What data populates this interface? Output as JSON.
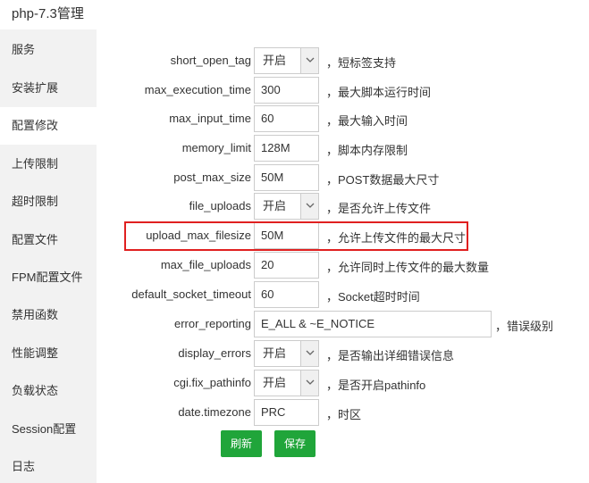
{
  "window": {
    "title": "php-7.3管理"
  },
  "sidebar": {
    "items": [
      {
        "label": "服务"
      },
      {
        "label": "安装扩展"
      },
      {
        "label": "配置修改"
      },
      {
        "label": "上传限制"
      },
      {
        "label": "超时限制"
      },
      {
        "label": "配置文件"
      },
      {
        "label": "FPM配置文件"
      },
      {
        "label": "禁用函数"
      },
      {
        "label": "性能调整"
      },
      {
        "label": "负载状态"
      },
      {
        "label": "Session配置"
      },
      {
        "label": "日志"
      }
    ],
    "active": "配置修改"
  },
  "settings": [
    {
      "name": "short_open_tag",
      "type": "select",
      "value": "开启",
      "desc": "，短标签支持"
    },
    {
      "name": "max_execution_time",
      "type": "text",
      "value": "300",
      "desc": "，最大脚本运行时间"
    },
    {
      "name": "max_input_time",
      "type": "text",
      "value": "60",
      "desc": "，最大输入时间"
    },
    {
      "name": "memory_limit",
      "type": "text",
      "value": "128M",
      "desc": "，脚本内存限制"
    },
    {
      "name": "post_max_size",
      "type": "text",
      "value": "50M",
      "desc": "，POST数据最大尺寸"
    },
    {
      "name": "file_uploads",
      "type": "select",
      "value": "开启",
      "desc": "，是否允许上传文件"
    },
    {
      "name": "upload_max_filesize",
      "type": "text",
      "value": "50M",
      "desc": "，允许上传文件的最大尺寸"
    },
    {
      "name": "max_file_uploads",
      "type": "text",
      "value": "20",
      "desc": "，允许同时上传文件的最大数量"
    },
    {
      "name": "default_socket_timeout",
      "type": "text",
      "value": "60",
      "desc": "，Socket超时时间"
    },
    {
      "name": "error_reporting",
      "type": "wide",
      "value": "E_ALL & ~E_NOTICE",
      "desc": "，错误级别"
    },
    {
      "name": "display_errors",
      "type": "select",
      "value": "开启",
      "desc": "，是否输出详细错误信息"
    },
    {
      "name": "cgi.fix_pathinfo",
      "type": "select",
      "value": "开启",
      "desc": "，是否开启pathinfo"
    },
    {
      "name": "date.timezone",
      "type": "text",
      "value": "PRC",
      "desc": "，时区"
    }
  ],
  "buttons": {
    "refresh": "刷新",
    "save": "保存"
  },
  "colors": {
    "accent": "#20a53a",
    "highlight": "#e02020",
    "sidebar_bg": "#f2f2f2"
  }
}
